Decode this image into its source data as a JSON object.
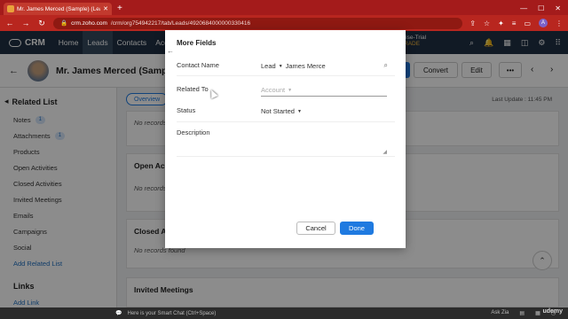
{
  "browser": {
    "tab_title": "Mr. James Merced (Sample) (Lea...",
    "url_host": "crm.zoho.com",
    "url_path": "/crm/org754942217/tab/Leads/4920684000000330416"
  },
  "crm": {
    "logo": "CRM",
    "nav": [
      "Home",
      "Leads",
      "Contacts",
      "Accou"
    ],
    "trial_line1": "rise-Trial",
    "trial_line2": "RADE"
  },
  "record": {
    "name": "Mr. James Merced (Sample)",
    "convert_label": "Convert",
    "edit_label": "Edit",
    "more_label": "•••"
  },
  "sidebar": {
    "title": "Related List",
    "items": [
      {
        "label": "Notes",
        "count": "1"
      },
      {
        "label": "Attachments",
        "count": "1"
      },
      {
        "label": "Products"
      },
      {
        "label": "Open Activities"
      },
      {
        "label": "Closed Activities"
      },
      {
        "label": "Invited Meetings"
      },
      {
        "label": "Emails"
      },
      {
        "label": "Campaigns"
      },
      {
        "label": "Social"
      }
    ],
    "add_related": "Add Related List",
    "links_title": "Links",
    "add_link": "Add Link"
  },
  "content": {
    "overview_tab": "Overview",
    "last_update": "Last Update : 11:45 PM",
    "cards": [
      {
        "title": "",
        "none": "No records"
      },
      {
        "title": "Open Ac",
        "none": "No records"
      },
      {
        "title": "Closed A",
        "none": "No records found"
      },
      {
        "title": "Invited Meetings",
        "none": ""
      }
    ]
  },
  "modal": {
    "title": "More Fields",
    "fields": [
      {
        "label": "Contact Name",
        "module": "Lead",
        "value": "James Merce"
      },
      {
        "label": "Related To",
        "value": "Account"
      },
      {
        "label": "Status",
        "value": "Not Started"
      },
      {
        "label": "Description",
        "value": ""
      }
    ],
    "cancel_label": "Cancel",
    "done_label": "Done"
  },
  "bottom": {
    "chat_placeholder": "Here is your Smart Chat (Ctrl+Space)",
    "ask_zia": "Ask Zia"
  },
  "watermark": "udemy"
}
